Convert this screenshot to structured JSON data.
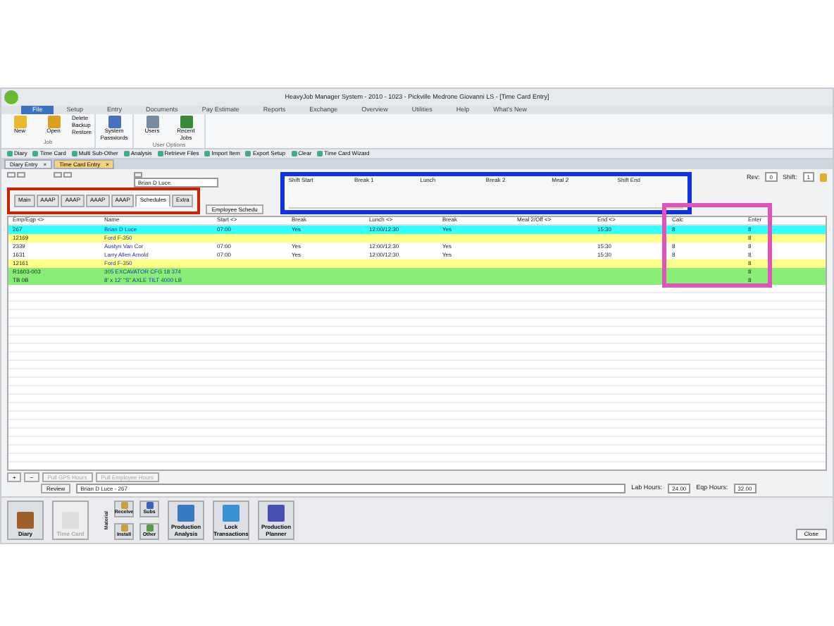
{
  "window": {
    "title": "HeavyJob Manager System - 2010 - 1023 - Pickville Medrone Giovanni LS - [Time Card Entry]"
  },
  "ribbon_tabs": [
    {
      "label": "File",
      "selected": true
    },
    {
      "label": "Setup",
      "selected": false
    },
    {
      "label": "Entry",
      "selected": false
    },
    {
      "label": "Documents",
      "selected": false
    },
    {
      "label": "Pay Estimate",
      "selected": false
    },
    {
      "label": "Reports",
      "selected": false
    },
    {
      "label": "Exchange",
      "selected": false
    },
    {
      "label": "Overview",
      "selected": false
    },
    {
      "label": "Utilities",
      "selected": false
    },
    {
      "label": "Help",
      "selected": false
    },
    {
      "label": "What's New",
      "selected": false
    }
  ],
  "ribbon_groups": [
    {
      "label": "Job",
      "buttons": [
        {
          "label": "New",
          "kind": "big"
        },
        {
          "label": "Open",
          "kind": "big"
        },
        {
          "label": "Delete",
          "kind": "small"
        },
        {
          "label": "Backup",
          "kind": "small"
        },
        {
          "label": "Restore",
          "kind": "small"
        }
      ]
    },
    {
      "buttons": [
        {
          "label": "System Passwords",
          "kind": "big"
        }
      ]
    },
    {
      "label": "User Options",
      "buttons": [
        {
          "label": "Users",
          "kind": "big"
        },
        {
          "label": "Recent Jobs",
          "kind": "big"
        }
      ]
    }
  ],
  "toolbar": [
    "Diary",
    "Time Card",
    "Multi Sub-Other",
    "Analysis",
    "Retrieve Files",
    "Import Item",
    "Export Setup",
    "Clear",
    "Time Card Wizard"
  ],
  "doc_tabs": [
    {
      "label": "Diary Entry",
      "close": "×",
      "selected": false
    },
    {
      "label": "Time Card Entry",
      "close": "×",
      "selected": true
    }
  ],
  "foreman": "Brian D Luce",
  "rev_label": "Rev:",
  "rev": "0",
  "shift_label": "Shift:",
  "shift": "1",
  "sub_tabs": [
    {
      "label": "Main",
      "selected": false
    },
    {
      "label": "AAAP",
      "selected": false
    },
    {
      "label": "AAAP",
      "selected": false
    },
    {
      "label": "AAAP",
      "selected": false
    },
    {
      "label": "AAAP",
      "selected": false
    },
    {
      "label": "Schedules",
      "selected": true
    },
    {
      "label": "Extra",
      "selected": false
    }
  ],
  "employee_schedule_button": "Employee Schedu",
  "schedule_fields": [
    "Shift Start",
    "Break 1",
    "Lunch",
    "Break 2",
    "Meal 2",
    "Shift End"
  ],
  "table": {
    "columns": [
      "Emp/Eqp <>",
      "Name",
      "Start <>",
      "Break",
      "Lunch <>",
      "Break",
      "Meal 2/Off <>",
      "End <>",
      "",
      "Calc",
      "Enter"
    ],
    "rows": [
      {
        "color": "#33ffff",
        "cells": [
          "267",
          "Brian D Luce",
          "07:00",
          "Yes",
          "12:00/12:30",
          "Yes",
          "",
          "15:30",
          "",
          "8",
          "8"
        ]
      },
      {
        "color": "#ffff88",
        "cells": [
          "12169",
          "Ford F-350",
          "",
          "",
          "",
          "",
          "",
          "",
          "",
          "",
          "8"
        ]
      },
      {
        "color": "#ffffff",
        "cells": [
          "2339",
          "Austyn Van Cor",
          "07:00",
          "Yes",
          "12:00/12:30",
          "Yes",
          "",
          "15:30",
          "",
          "8",
          "8"
        ]
      },
      {
        "color": "#ffffff",
        "cells": [
          "1631",
          "Larry Allen Arnold",
          "07:00",
          "Yes",
          "12:00/12:30",
          "Yes",
          "",
          "15:30",
          "",
          "8",
          "8"
        ]
      },
      {
        "color": "#ffff88",
        "cells": [
          "12161",
          "Ford F-350",
          "",
          "",
          "",
          "",
          "",
          "",
          "",
          "",
          "8"
        ]
      },
      {
        "color": "#88ee77",
        "cells": [
          "R1603-003",
          "305 EXCAVATOR CFG 18 374",
          "",
          "",
          "",
          "",
          "",
          "",
          "",
          "",
          "8"
        ]
      },
      {
        "color": "#88ee77",
        "cells": [
          "TB 0B",
          "8' x 12' \"S\" AXLE TILT 4000 LB",
          "",
          "",
          "",
          "",
          "",
          "",
          "",
          "",
          "8"
        ]
      }
    ]
  },
  "grid_buttons": [
    {
      "label": "+",
      "disabled": false
    },
    {
      "label": "−",
      "disabled": false
    },
    {
      "label": "Pull GPS Hours",
      "disabled": true
    },
    {
      "label": "Pull Employee Hours",
      "disabled": true
    }
  ],
  "review_button": "Review",
  "review_field": "Brian D Luce - 267",
  "lab_hours_label": "Lab Hours:",
  "lab_hours": "24.00",
  "eqp_hours_label": "Eqp Hours:",
  "eqp_hours": "32.00",
  "launcher": [
    {
      "label": "Diary",
      "kind": "big",
      "disabled": false
    },
    {
      "label": "Time Card",
      "kind": "big",
      "disabled": true
    },
    {
      "label": "Material",
      "kind": "vertical"
    },
    {
      "label": "Receive",
      "kind": "small",
      "disabled": false
    },
    {
      "label": "Subs",
      "kind": "small",
      "disabled": false
    },
    {
      "label": "Install",
      "kind": "small",
      "disabled": false
    },
    {
      "label": "Other",
      "kind": "small",
      "disabled": false
    },
    {
      "label": "Production Analysis",
      "kind": "big",
      "disabled": false
    },
    {
      "label": "Lock Transactions",
      "kind": "big",
      "disabled": false
    },
    {
      "label": "Production Planner",
      "kind": "big",
      "disabled": false
    }
  ],
  "close_button": "Close",
  "highlights": [
    {
      "color": "#cc2200"
    },
    {
      "color": "#1133dd"
    },
    {
      "color": "#dd55bb"
    }
  ]
}
